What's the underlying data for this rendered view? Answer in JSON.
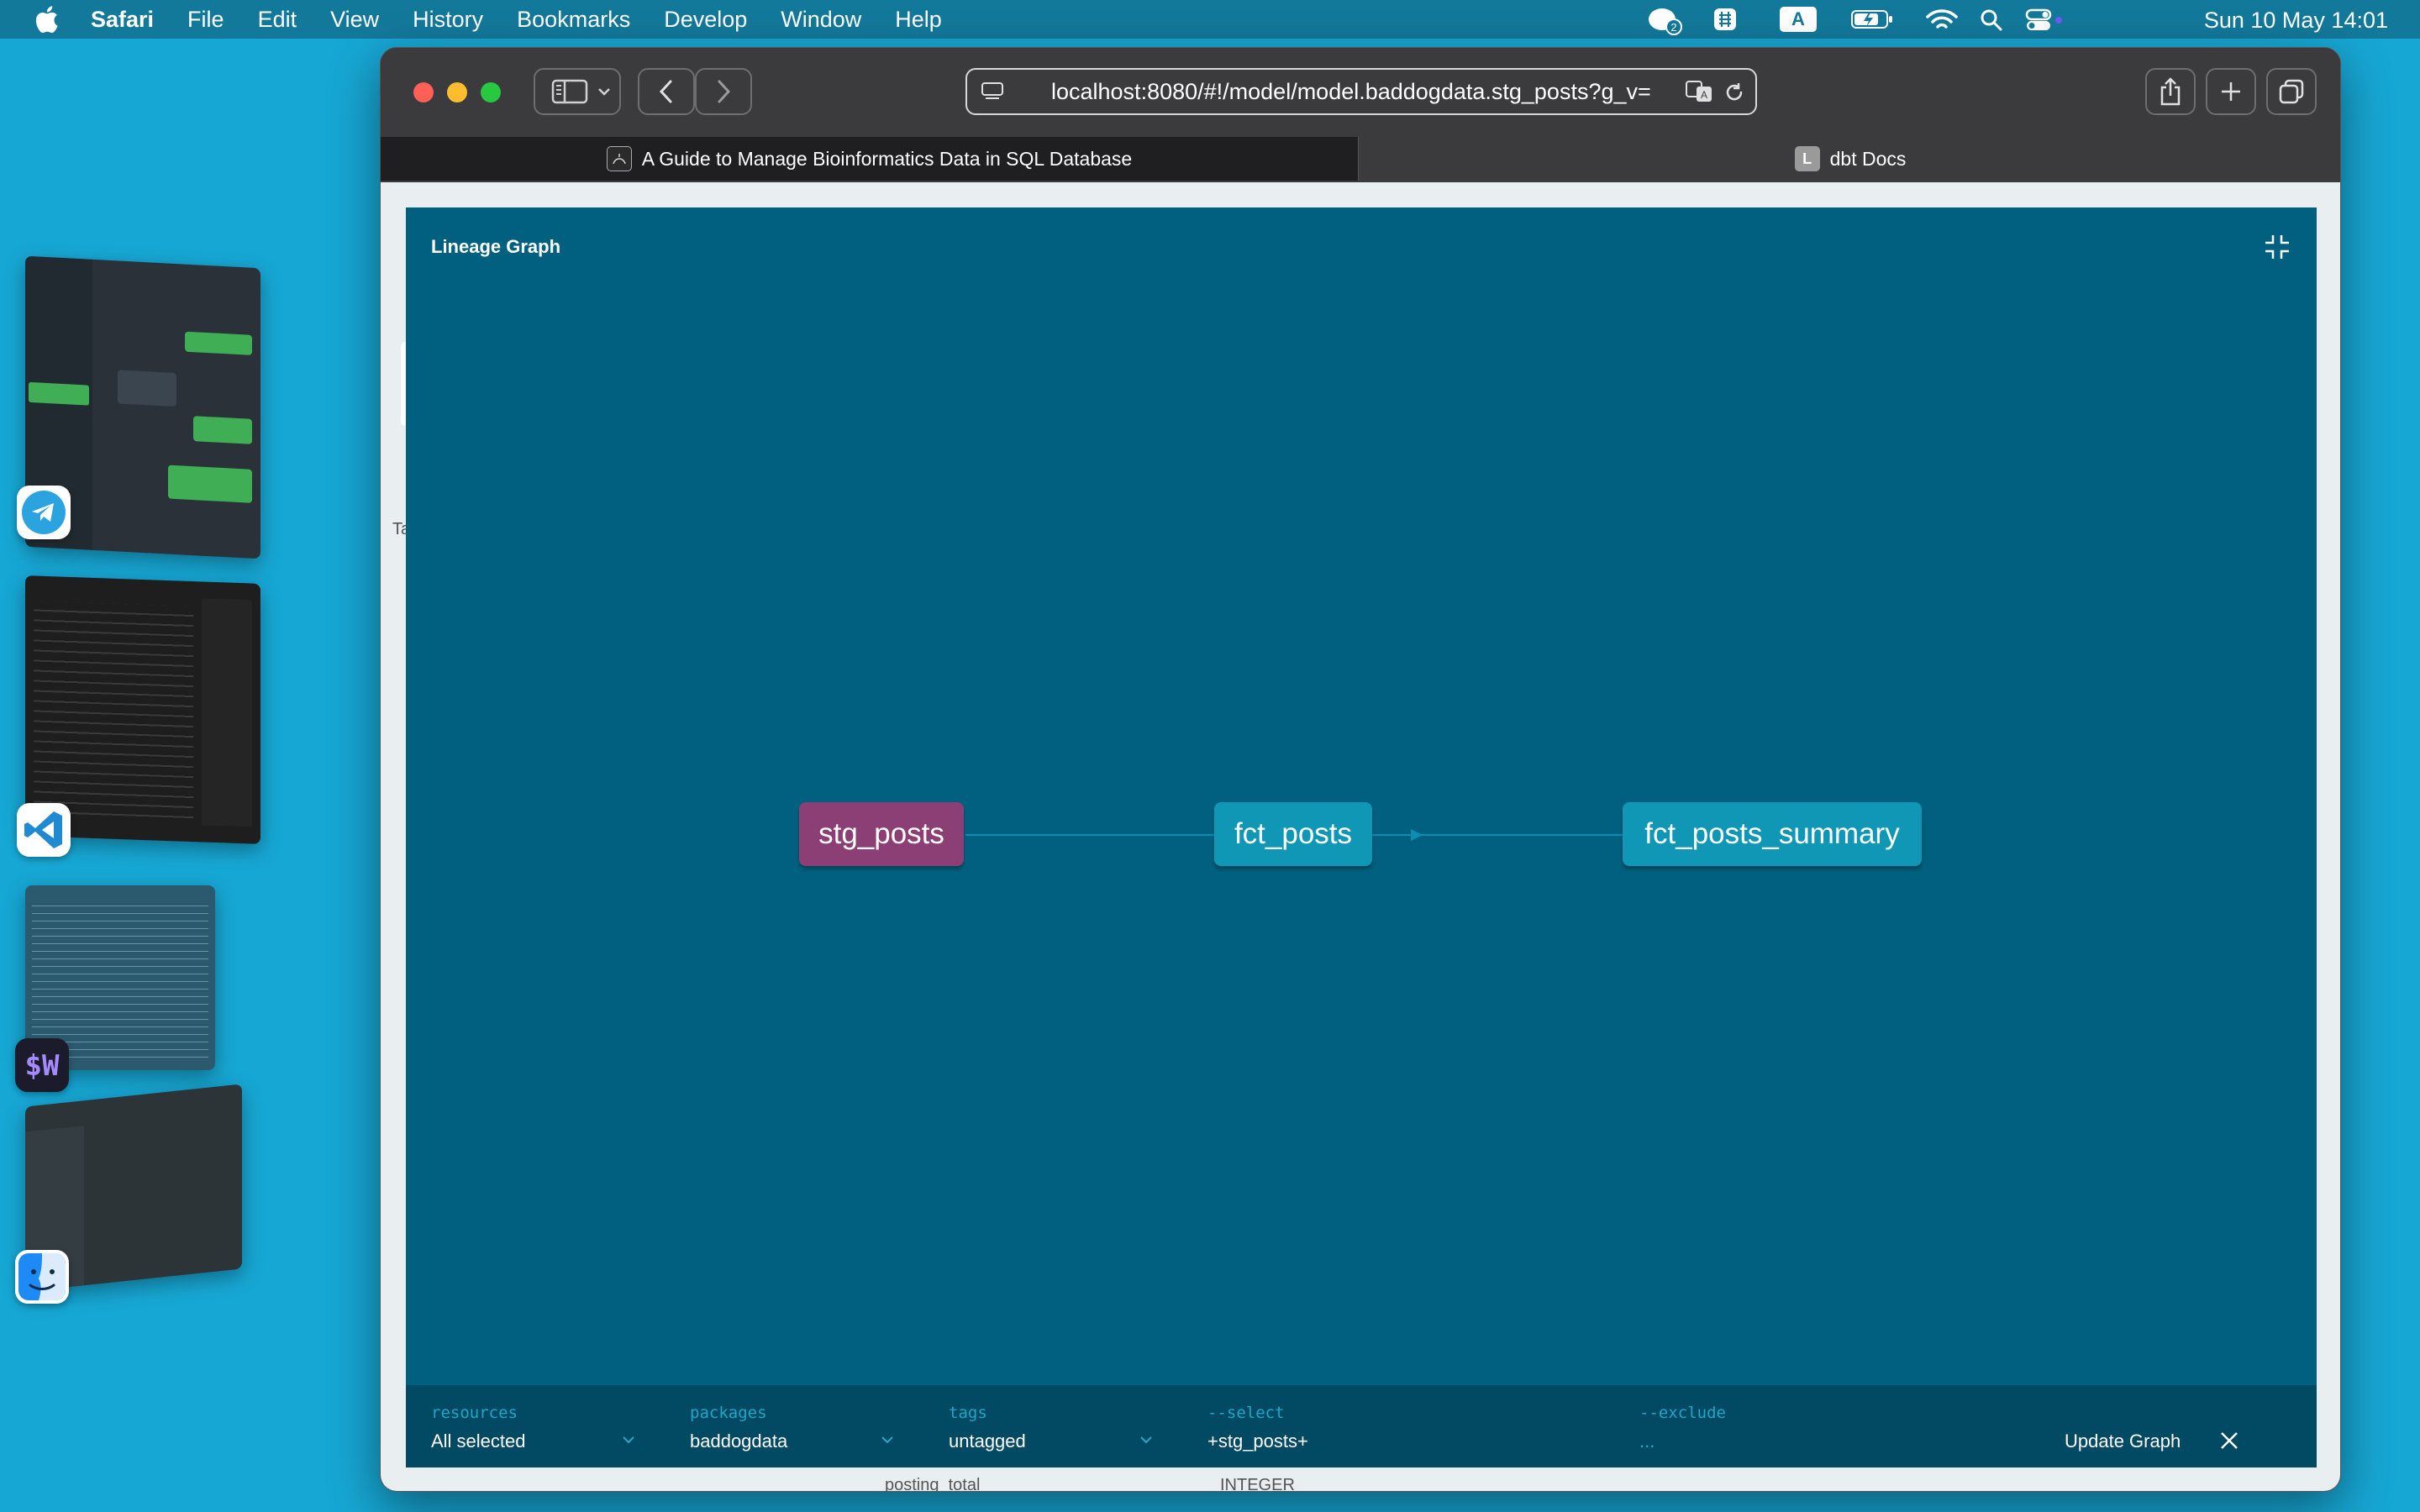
{
  "menubar": {
    "app_name": "Safari",
    "items": [
      "File",
      "Edit",
      "View",
      "History",
      "Bookmarks",
      "Develop",
      "Window",
      "Help"
    ],
    "clock": "Sun 10 May  14:01",
    "notification_badge": "2",
    "input_source": "A"
  },
  "browser": {
    "url": "localhost:8080/#!/model/model.baddogdata.stg_posts?g_v=",
    "tabs": [
      {
        "title": "A Guide to Manage Bioinformatics Data in SQL Database",
        "active": false
      },
      {
        "title": "dbt Docs",
        "active": true,
        "favicon_letter": "L"
      }
    ]
  },
  "lineage": {
    "title": "Lineage Graph",
    "nodes": [
      {
        "label": "stg_posts",
        "color": "#8b3f74"
      },
      {
        "label": "fct_posts",
        "color": "#0f97b5"
      },
      {
        "label": "fct_posts_summary",
        "color": "#0f97b5"
      }
    ],
    "filters": [
      {
        "label": "resources",
        "value": "All selected"
      },
      {
        "label": "packages",
        "value": "baddogdata"
      },
      {
        "label": "tags",
        "value": "untagged"
      },
      {
        "label": "--select",
        "value": "+stg_posts+"
      },
      {
        "label": "--exclude",
        "value": "..."
      }
    ],
    "update_label": "Update Graph"
  },
  "underpage": {
    "partial_label": "Ta",
    "row_name": "posting_total",
    "row_type": "INTEGER"
  },
  "colors": {
    "desktop": "#17a7d4",
    "panel": "#01607f",
    "filterbar": "#024a63",
    "selected_node": "#8b3f74",
    "node": "#0f97b5"
  }
}
